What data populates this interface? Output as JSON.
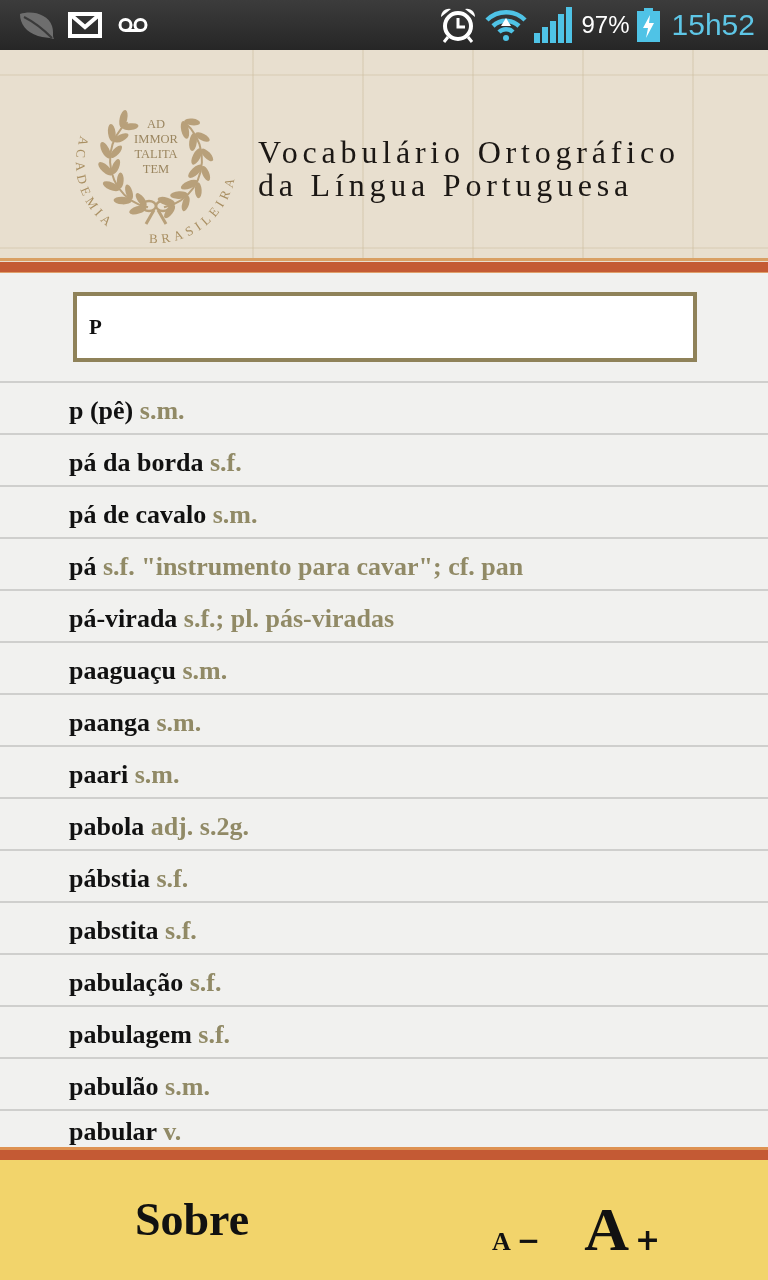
{
  "status_bar": {
    "battery": "97%",
    "time": "15h52"
  },
  "header": {
    "emblem": {
      "motto": [
        "AD",
        "IMMOR",
        "TALITA",
        "TEM"
      ],
      "ring_words": [
        "ACADEMIA",
        "BRASILEIRA"
      ]
    },
    "title_lines": [
      "Vocabulário Ortográfico",
      "da Língua Portuguesa"
    ]
  },
  "search": {
    "value": "P"
  },
  "entries": [
    {
      "headword": "p (pê)",
      "info": "s.m."
    },
    {
      "headword": "pá da borda",
      "info": "s.f."
    },
    {
      "headword": "pá de cavalo",
      "info": "s.m."
    },
    {
      "headword": "pá",
      "info": "s.f. \"instrumento para cavar\"; cf. pan"
    },
    {
      "headword": "pá-virada",
      "info": "s.f.; pl. pás-viradas"
    },
    {
      "headword": "paaguaçu",
      "info": "s.m."
    },
    {
      "headword": "paanga",
      "info": "s.m."
    },
    {
      "headword": "paari",
      "info": "s.m."
    },
    {
      "headword": "pabola",
      "info": "adj. s.2g."
    },
    {
      "headword": "pábstia",
      "info": "s.f."
    },
    {
      "headword": "pabstita",
      "info": "s.f."
    },
    {
      "headword": "pabulação",
      "info": "s.f."
    },
    {
      "headword": "pabulagem",
      "info": "s.f."
    },
    {
      "headword": "pabulão",
      "info": "s.m."
    },
    {
      "headword": "pabular",
      "info": "v."
    }
  ],
  "bottom_bar": {
    "about_button": "Sobre",
    "font_buttons": [
      {
        "kind": "decrease",
        "letter": "A",
        "sign": "−"
      },
      {
        "kind": "increase",
        "letter": "A",
        "sign": "+"
      }
    ]
  }
}
